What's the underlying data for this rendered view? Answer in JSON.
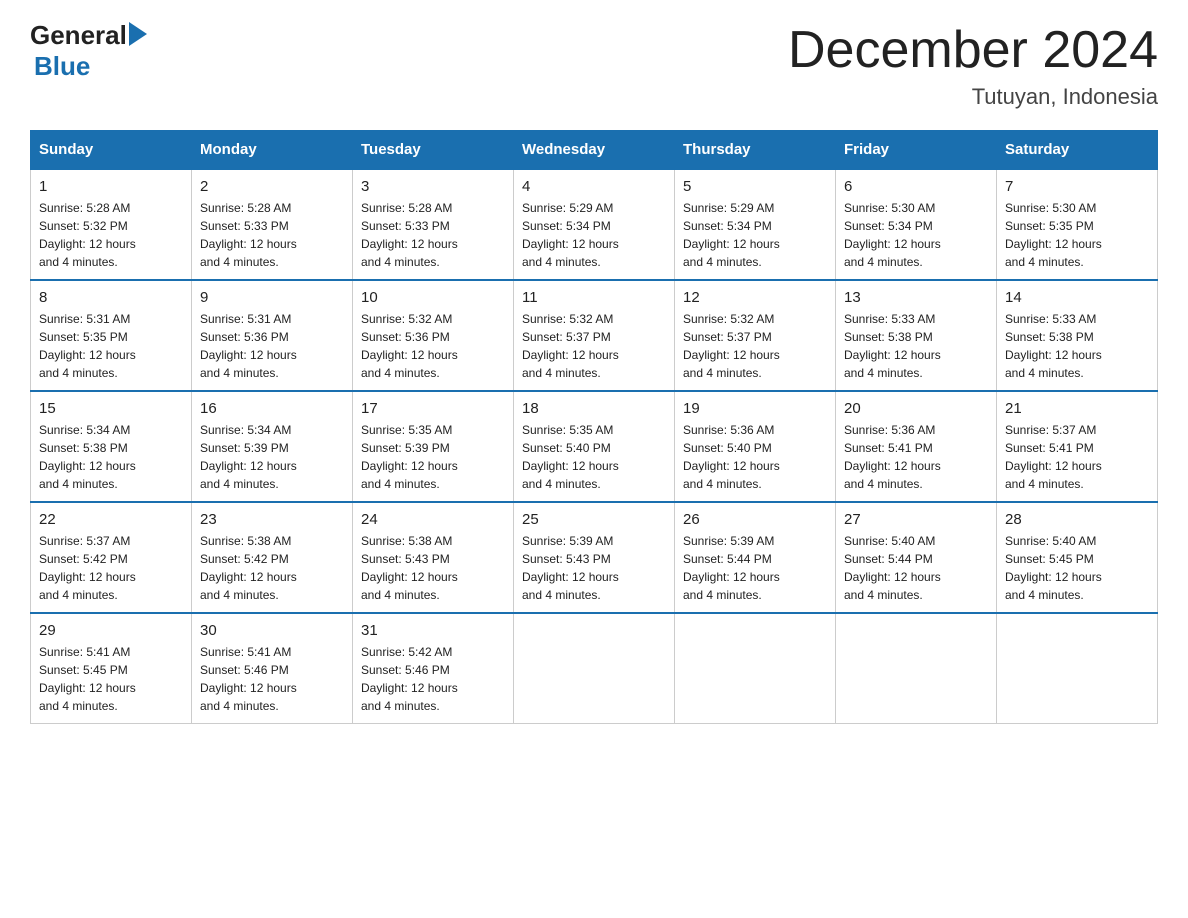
{
  "logo": {
    "general": "General",
    "blue": "Blue"
  },
  "title": "December 2024",
  "location": "Tutuyan, Indonesia",
  "days_of_week": [
    "Sunday",
    "Monday",
    "Tuesday",
    "Wednesday",
    "Thursday",
    "Friday",
    "Saturday"
  ],
  "weeks": [
    [
      {
        "day": "1",
        "sunrise": "5:28 AM",
        "sunset": "5:32 PM",
        "daylight": "12 hours and 4 minutes."
      },
      {
        "day": "2",
        "sunrise": "5:28 AM",
        "sunset": "5:33 PM",
        "daylight": "12 hours and 4 minutes."
      },
      {
        "day": "3",
        "sunrise": "5:28 AM",
        "sunset": "5:33 PM",
        "daylight": "12 hours and 4 minutes."
      },
      {
        "day": "4",
        "sunrise": "5:29 AM",
        "sunset": "5:34 PM",
        "daylight": "12 hours and 4 minutes."
      },
      {
        "day": "5",
        "sunrise": "5:29 AM",
        "sunset": "5:34 PM",
        "daylight": "12 hours and 4 minutes."
      },
      {
        "day": "6",
        "sunrise": "5:30 AM",
        "sunset": "5:34 PM",
        "daylight": "12 hours and 4 minutes."
      },
      {
        "day": "7",
        "sunrise": "5:30 AM",
        "sunset": "5:35 PM",
        "daylight": "12 hours and 4 minutes."
      }
    ],
    [
      {
        "day": "8",
        "sunrise": "5:31 AM",
        "sunset": "5:35 PM",
        "daylight": "12 hours and 4 minutes."
      },
      {
        "day": "9",
        "sunrise": "5:31 AM",
        "sunset": "5:36 PM",
        "daylight": "12 hours and 4 minutes."
      },
      {
        "day": "10",
        "sunrise": "5:32 AM",
        "sunset": "5:36 PM",
        "daylight": "12 hours and 4 minutes."
      },
      {
        "day": "11",
        "sunrise": "5:32 AM",
        "sunset": "5:37 PM",
        "daylight": "12 hours and 4 minutes."
      },
      {
        "day": "12",
        "sunrise": "5:32 AM",
        "sunset": "5:37 PM",
        "daylight": "12 hours and 4 minutes."
      },
      {
        "day": "13",
        "sunrise": "5:33 AM",
        "sunset": "5:38 PM",
        "daylight": "12 hours and 4 minutes."
      },
      {
        "day": "14",
        "sunrise": "5:33 AM",
        "sunset": "5:38 PM",
        "daylight": "12 hours and 4 minutes."
      }
    ],
    [
      {
        "day": "15",
        "sunrise": "5:34 AM",
        "sunset": "5:38 PM",
        "daylight": "12 hours and 4 minutes."
      },
      {
        "day": "16",
        "sunrise": "5:34 AM",
        "sunset": "5:39 PM",
        "daylight": "12 hours and 4 minutes."
      },
      {
        "day": "17",
        "sunrise": "5:35 AM",
        "sunset": "5:39 PM",
        "daylight": "12 hours and 4 minutes."
      },
      {
        "day": "18",
        "sunrise": "5:35 AM",
        "sunset": "5:40 PM",
        "daylight": "12 hours and 4 minutes."
      },
      {
        "day": "19",
        "sunrise": "5:36 AM",
        "sunset": "5:40 PM",
        "daylight": "12 hours and 4 minutes."
      },
      {
        "day": "20",
        "sunrise": "5:36 AM",
        "sunset": "5:41 PM",
        "daylight": "12 hours and 4 minutes."
      },
      {
        "day": "21",
        "sunrise": "5:37 AM",
        "sunset": "5:41 PM",
        "daylight": "12 hours and 4 minutes."
      }
    ],
    [
      {
        "day": "22",
        "sunrise": "5:37 AM",
        "sunset": "5:42 PM",
        "daylight": "12 hours and 4 minutes."
      },
      {
        "day": "23",
        "sunrise": "5:38 AM",
        "sunset": "5:42 PM",
        "daylight": "12 hours and 4 minutes."
      },
      {
        "day": "24",
        "sunrise": "5:38 AM",
        "sunset": "5:43 PM",
        "daylight": "12 hours and 4 minutes."
      },
      {
        "day": "25",
        "sunrise": "5:39 AM",
        "sunset": "5:43 PM",
        "daylight": "12 hours and 4 minutes."
      },
      {
        "day": "26",
        "sunrise": "5:39 AM",
        "sunset": "5:44 PM",
        "daylight": "12 hours and 4 minutes."
      },
      {
        "day": "27",
        "sunrise": "5:40 AM",
        "sunset": "5:44 PM",
        "daylight": "12 hours and 4 minutes."
      },
      {
        "day": "28",
        "sunrise": "5:40 AM",
        "sunset": "5:45 PM",
        "daylight": "12 hours and 4 minutes."
      }
    ],
    [
      {
        "day": "29",
        "sunrise": "5:41 AM",
        "sunset": "5:45 PM",
        "daylight": "12 hours and 4 minutes."
      },
      {
        "day": "30",
        "sunrise": "5:41 AM",
        "sunset": "5:46 PM",
        "daylight": "12 hours and 4 minutes."
      },
      {
        "day": "31",
        "sunrise": "5:42 AM",
        "sunset": "5:46 PM",
        "daylight": "12 hours and 4 minutes."
      },
      null,
      null,
      null,
      null
    ]
  ],
  "labels": {
    "sunrise": "Sunrise:",
    "sunset": "Sunset:",
    "daylight": "Daylight:"
  }
}
